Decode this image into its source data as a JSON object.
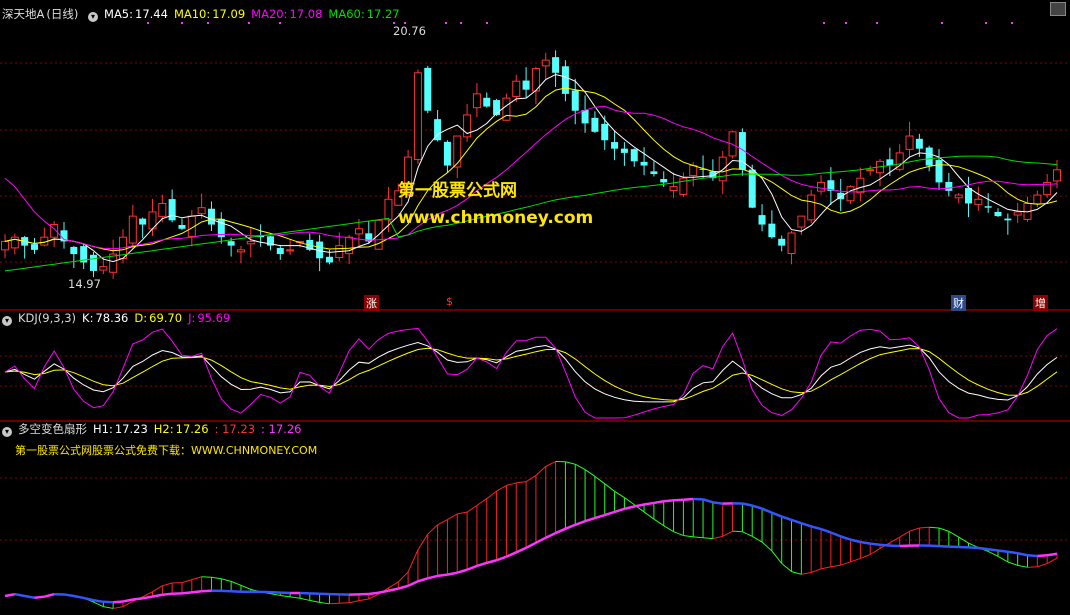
{
  "panel_main": {
    "stock_name": "深天地A",
    "period": "(日线)",
    "ma5_label": "MA5:",
    "ma5_value": "17.44",
    "ma10_label": "MA10:",
    "ma10_value": "17.09",
    "ma20_label": "MA20:",
    "ma20_value": "17.08",
    "ma60_label": "MA60:",
    "ma60_value": "17.27",
    "high_label": "20.76",
    "low_label": "14.97",
    "watermark_cn": "第一股票公式网",
    "watermark_url": "www.chnmoney.com",
    "signals": [
      "涨",
      "$",
      "财",
      "增"
    ]
  },
  "panel_kdj": {
    "title": "KDJ(9,3,3)",
    "k_label": "K:",
    "k_value": "78.36",
    "d_label": "D:",
    "d_value": "69.70",
    "j_label": "J:",
    "j_value": "95.69"
  },
  "panel_fan": {
    "title": "多空变色扇形",
    "h1_label": "H1:",
    "h1_value": "17.23",
    "h2_label": "H2:",
    "h2_value": "17.26",
    "v3": ": 17.23",
    "v4": ": 17.26",
    "note": "第一股票公式网股票公式免费下载：WWW.CHNMONEY.COM"
  },
  "colors": {
    "up": "#ff3232",
    "down": "#54ffff",
    "ma5": "#ffffff",
    "ma10": "#ffff00",
    "ma20": "#ff00ff",
    "ma60": "#00dd00",
    "grid": "#8b0000",
    "k": "#ffffff",
    "d": "#ffff00",
    "j": "#ff00ff",
    "fan_up": "#ff2020",
    "fan_down": "#20ff20",
    "h2_up": "#ff33ff",
    "h2_down": "#3355ff"
  },
  "chart_data": {
    "type": "candlestick",
    "candle_count": 108,
    "y_high": 20.76,
    "y_low": 14.97,
    "close_series": [
      15.8,
      15.9,
      15.7,
      15.6,
      15.9,
      16.2,
      15.8,
      15.5,
      15.3,
      15.1,
      15.2,
      15.5,
      15.9,
      16.4,
      16.2,
      16.5,
      16.7,
      16.3,
      16.1,
      16.4,
      16.6,
      16.2,
      15.9,
      15.7,
      15.6,
      15.8,
      15.9,
      15.7,
      15.5,
      15.6,
      15.8,
      15.6,
      15.4,
      15.3,
      15.7,
      15.9,
      16.1,
      15.8,
      16.3,
      16.8,
      17.0,
      17.8,
      19.8,
      18.9,
      18.2,
      17.6,
      18.3,
      18.8,
      19.3,
      19.0,
      18.8,
      19.2,
      19.6,
      19.4,
      19.9,
      20.1,
      19.8,
      19.3,
      18.9,
      18.6,
      18.4,
      18.2,
      18.0,
      17.9,
      17.7,
      17.6,
      17.4,
      17.2,
      17.1,
      17.3,
      17.6,
      17.5,
      17.3,
      17.8,
      18.4,
      17.5,
      16.6,
      16.2,
      15.9,
      15.7,
      16.0,
      16.4,
      16.9,
      17.2,
      17.0,
      16.8,
      17.1,
      17.3,
      17.5,
      17.7,
      17.6,
      17.9,
      18.3,
      18.0,
      17.6,
      17.2,
      17.0,
      16.9,
      16.7,
      16.8,
      16.6,
      16.4,
      16.3,
      16.5,
      16.7,
      16.9,
      17.2,
      17.5
    ],
    "kdj": {
      "k_last": 78.36,
      "d_last": 69.7,
      "j_last": 95.69
    },
    "fan": {
      "h1_last": 17.23,
      "h2_last": 17.26
    }
  }
}
